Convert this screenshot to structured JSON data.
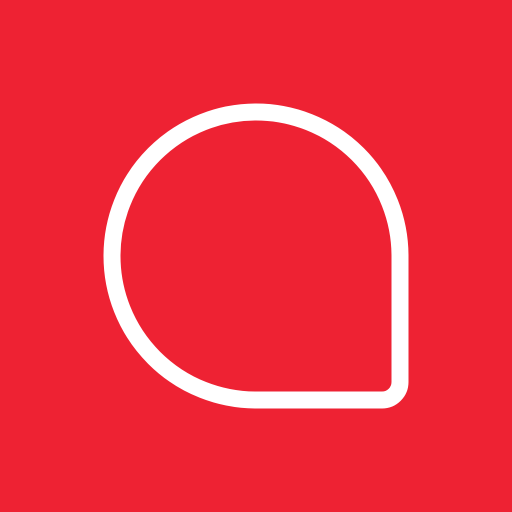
{
  "colors": {
    "background": "#ee2233",
    "stroke": "#ffffff"
  },
  "icon": {
    "name": "speech-bubble-icon"
  }
}
